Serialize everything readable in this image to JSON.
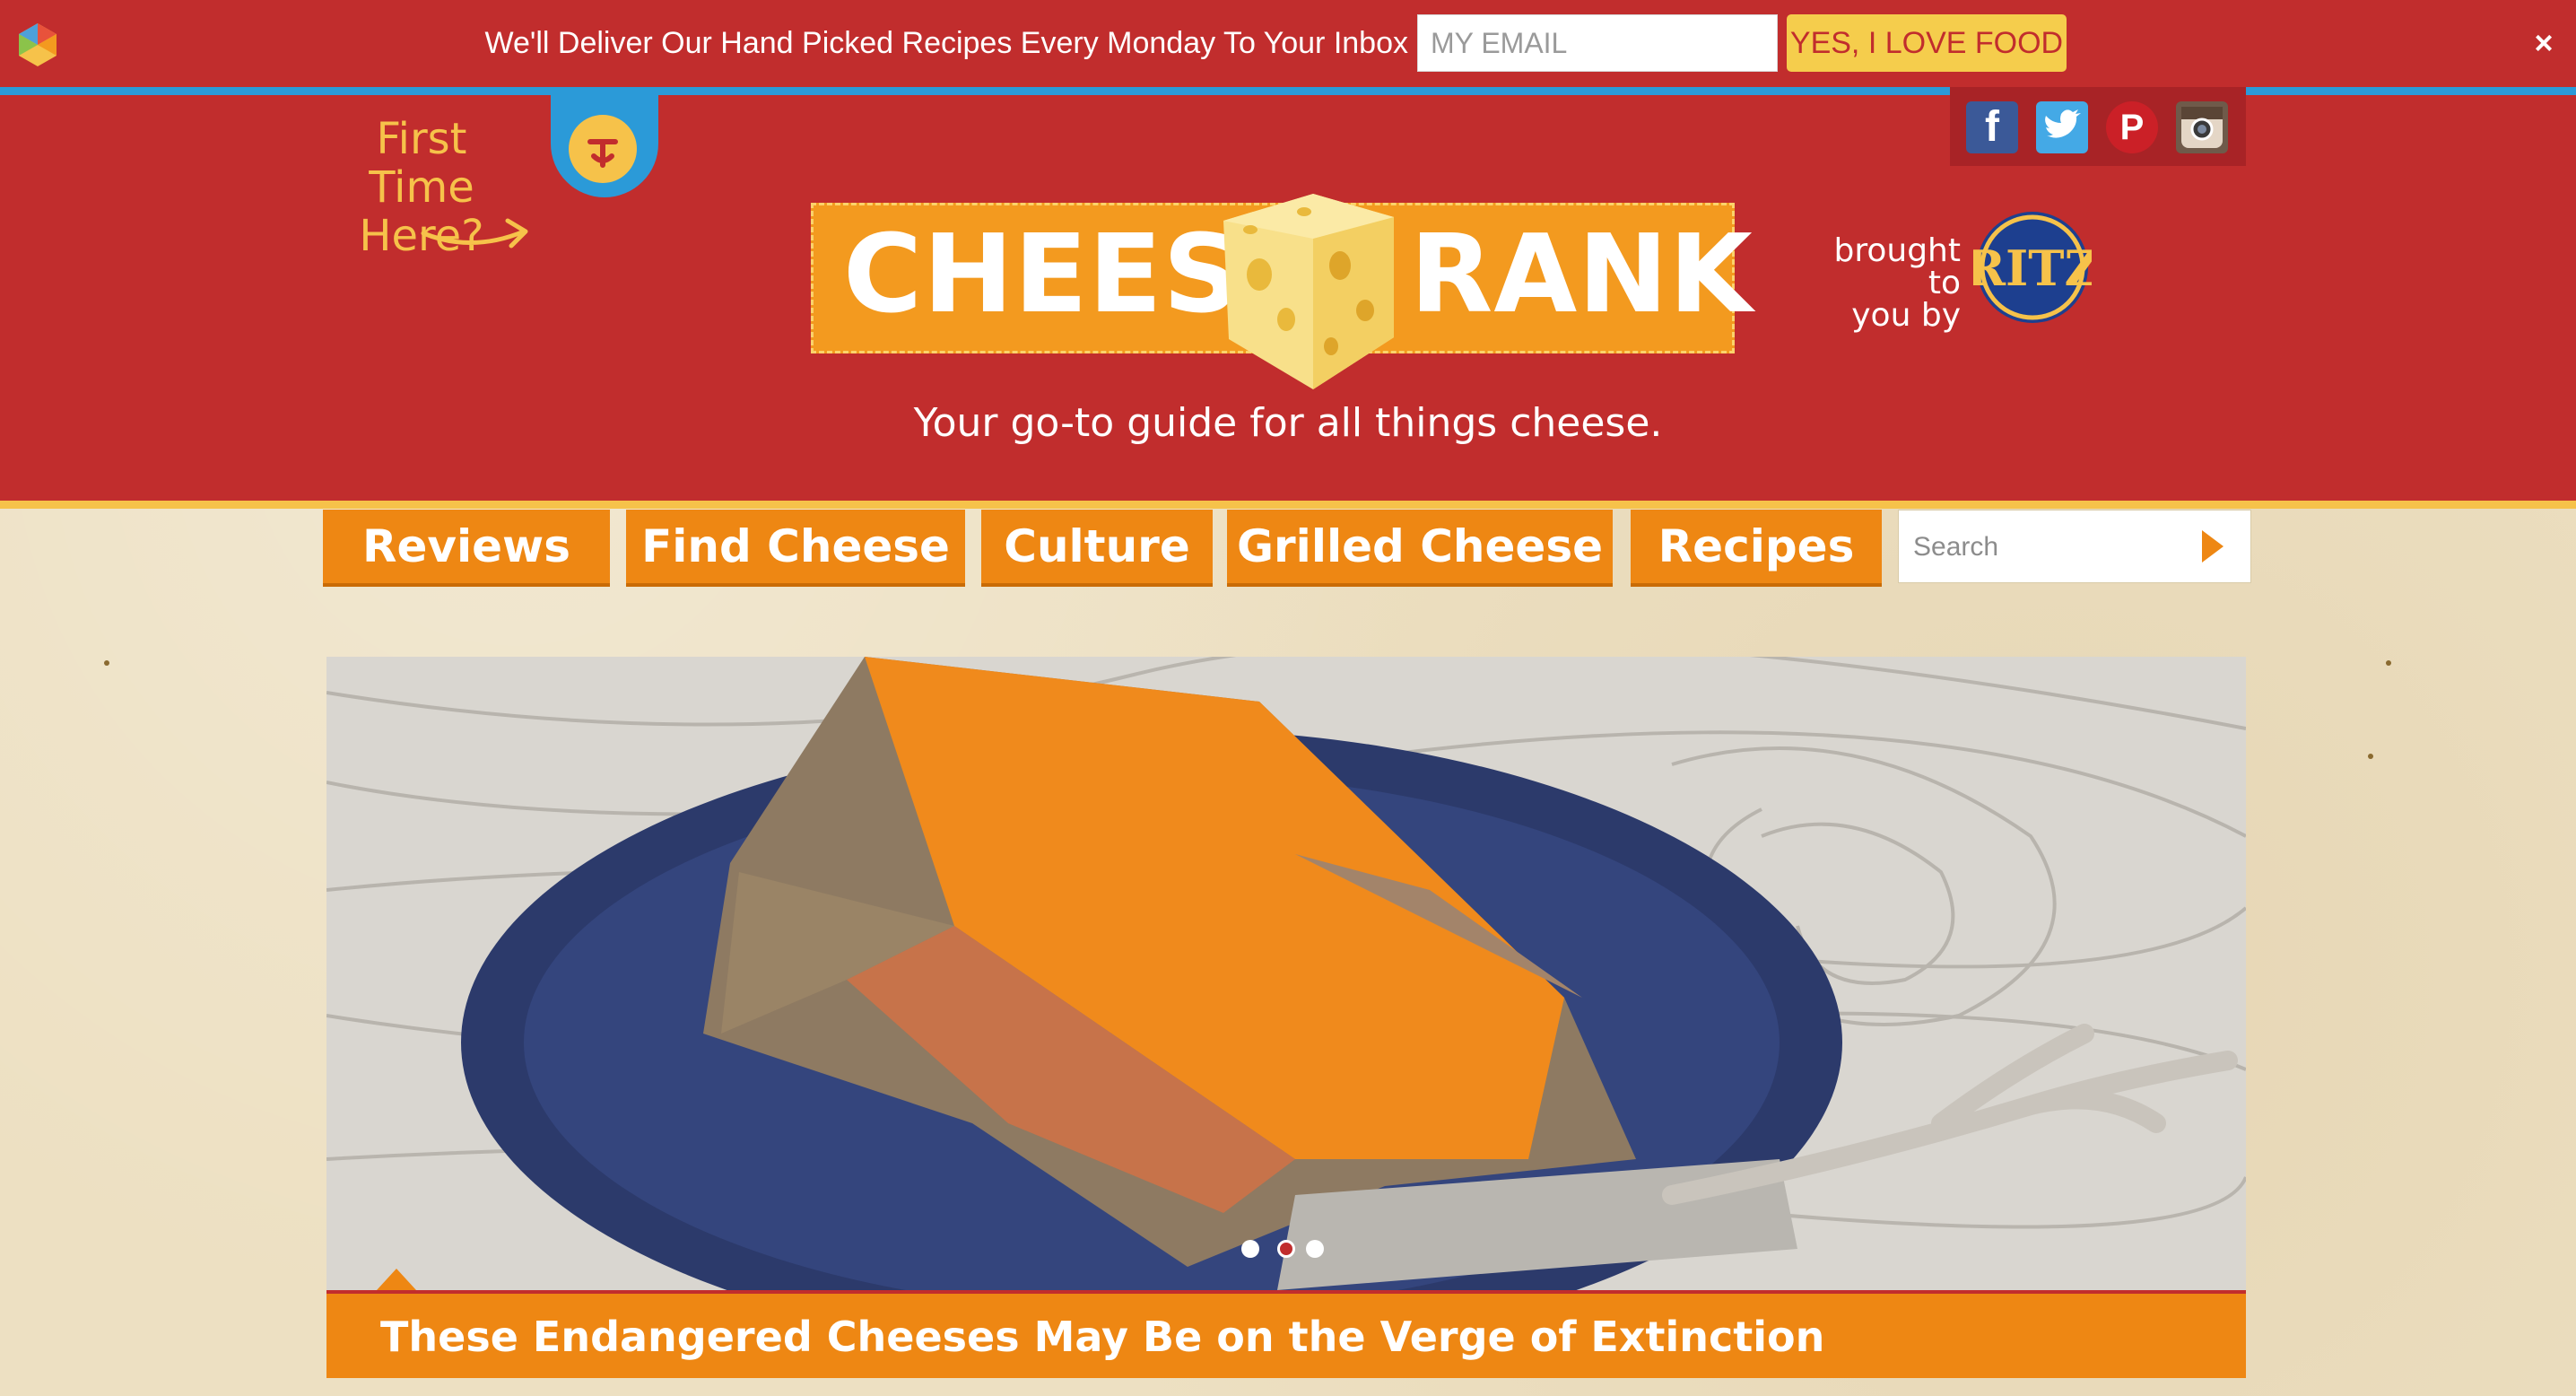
{
  "promo": {
    "text": "We'll Deliver Our Hand Picked Recipes Every Monday To Your Inbox",
    "email_placeholder": "MY EMAIL",
    "button_label": "YES, I LOVE FOOD",
    "close_label": "×"
  },
  "header": {
    "first_time_line1": "First Time",
    "first_time_line2": "Here?",
    "logo_left": "CHEESE",
    "logo_right": "RANK",
    "tagline": "Your go-to guide for all things cheese.",
    "brought_line1": "brought to",
    "brought_line2": "you by",
    "sponsor": "RITZ",
    "social": [
      "facebook-icon",
      "twitter-icon",
      "pinterest-icon",
      "instagram-icon"
    ]
  },
  "nav": {
    "items": [
      {
        "label": "Reviews"
      },
      {
        "label": "Find Cheese"
      },
      {
        "label": "Culture"
      },
      {
        "label": "Grilled Cheese"
      },
      {
        "label": "Recipes"
      }
    ],
    "search_placeholder": "Search"
  },
  "hero": {
    "caption": "These Endangered Cheeses May Be on the Verge of Extinction",
    "active_slide": 2,
    "slide_count": 3
  },
  "colors": {
    "brand_red": "#c12d2d",
    "accent_orange": "#ee8713",
    "accent_yellow": "#f6c24a",
    "accent_blue": "#2b9ad8"
  }
}
